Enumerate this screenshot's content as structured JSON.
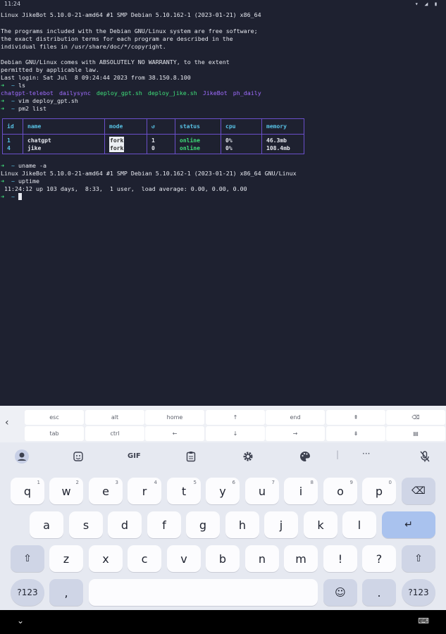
{
  "status_bar": {
    "time": "11:24",
    "icons": "▾ ◢ ▮"
  },
  "terminal": {
    "header_line": "Linux JikeBot 5.10.0-21-amd64 #1 SMP Debian 5.10.162-1 (2023-01-21) x86_64",
    "motd": [
      "The programs included with the Debian GNU/Linux system are free software;",
      "the exact distribution terms for each program are described in the",
      "individual files in /usr/share/doc/*/copyright.",
      "",
      "Debian GNU/Linux comes with ABSOLUTELY NO WARRANTY, to the extent",
      "permitted by applicable law.",
      "Last login: Sat Jul  8 09:24:44 2023 from 38.150.8.100"
    ],
    "prompt_arrow": "➜",
    "prompt_dir": "~",
    "cmd_ls": "ls",
    "ls_items": [
      {
        "name": "chatgpt-telebot",
        "kind": "dir"
      },
      {
        "name": "dailysync",
        "kind": "dir"
      },
      {
        "name": "deploy_gpt.sh",
        "kind": "sh"
      },
      {
        "name": "deploy_jike.sh",
        "kind": "sh"
      },
      {
        "name": "JikeBot",
        "kind": "dir"
      },
      {
        "name": "ph_daily",
        "kind": "dir"
      }
    ],
    "cmd_vim": "vim deploy_gpt.sh",
    "cmd_pm2": "pm2 list",
    "pm2": {
      "headers": [
        "id",
        "name",
        "mode",
        "↺",
        "status",
        "cpu",
        "memory"
      ],
      "rows": [
        {
          "id": "1",
          "name": "chatgpt",
          "mode": "fork",
          "restarts": "1",
          "status": "online",
          "cpu": "0%",
          "memory": "46.3mb"
        },
        {
          "id": "4",
          "name": "jike",
          "mode": "fork",
          "restarts": "0",
          "status": "online",
          "cpu": "0%",
          "memory": "108.4mb"
        }
      ]
    },
    "cmd_uname": "uname -a",
    "uname_output": "Linux JikeBot 5.10.0-21-amd64 #1 SMP Debian 5.10.162-1 (2023-01-21) x86_64 GNU/Linux",
    "cmd_uptime": "uptime",
    "uptime_output": " 11:24:12 up 103 days,  8:33,  1 user,  load average: 0.00, 0.00, 0.00"
  },
  "extra_keys": {
    "back": "‹",
    "row1": [
      "esc",
      "alt",
      "home",
      "↑",
      "end",
      "⇞",
      "⌫"
    ],
    "row2": [
      "tab",
      "ctrl",
      "←",
      "↓",
      "→",
      "⇟",
      "▤"
    ]
  },
  "kb_toolbar": {
    "gif": "GIF",
    "more": "···"
  },
  "keyboard": {
    "row1": [
      {
        "k": "q",
        "h": "1"
      },
      {
        "k": "w",
        "h": "2"
      },
      {
        "k": "e",
        "h": "3"
      },
      {
        "k": "r",
        "h": "4"
      },
      {
        "k": "t",
        "h": "5"
      },
      {
        "k": "y",
        "h": "6"
      },
      {
        "k": "u",
        "h": "7"
      },
      {
        "k": "i",
        "h": "8"
      },
      {
        "k": "o",
        "h": "9"
      },
      {
        "k": "p",
        "h": "0"
      }
    ],
    "row2": [
      "a",
      "s",
      "d",
      "f",
      "g",
      "h",
      "j",
      "k",
      "l"
    ],
    "row3": [
      "z",
      "x",
      "c",
      "v",
      "b",
      "n",
      "m",
      "!",
      "?"
    ],
    "sym": "?123",
    "comma": ",",
    "period": ".",
    "enter": "↵",
    "shift": "⇧",
    "backspace": "⌫",
    "emoji": "☺"
  },
  "nav": {
    "chevron": "⌄",
    "keyboard": "⌨"
  }
}
